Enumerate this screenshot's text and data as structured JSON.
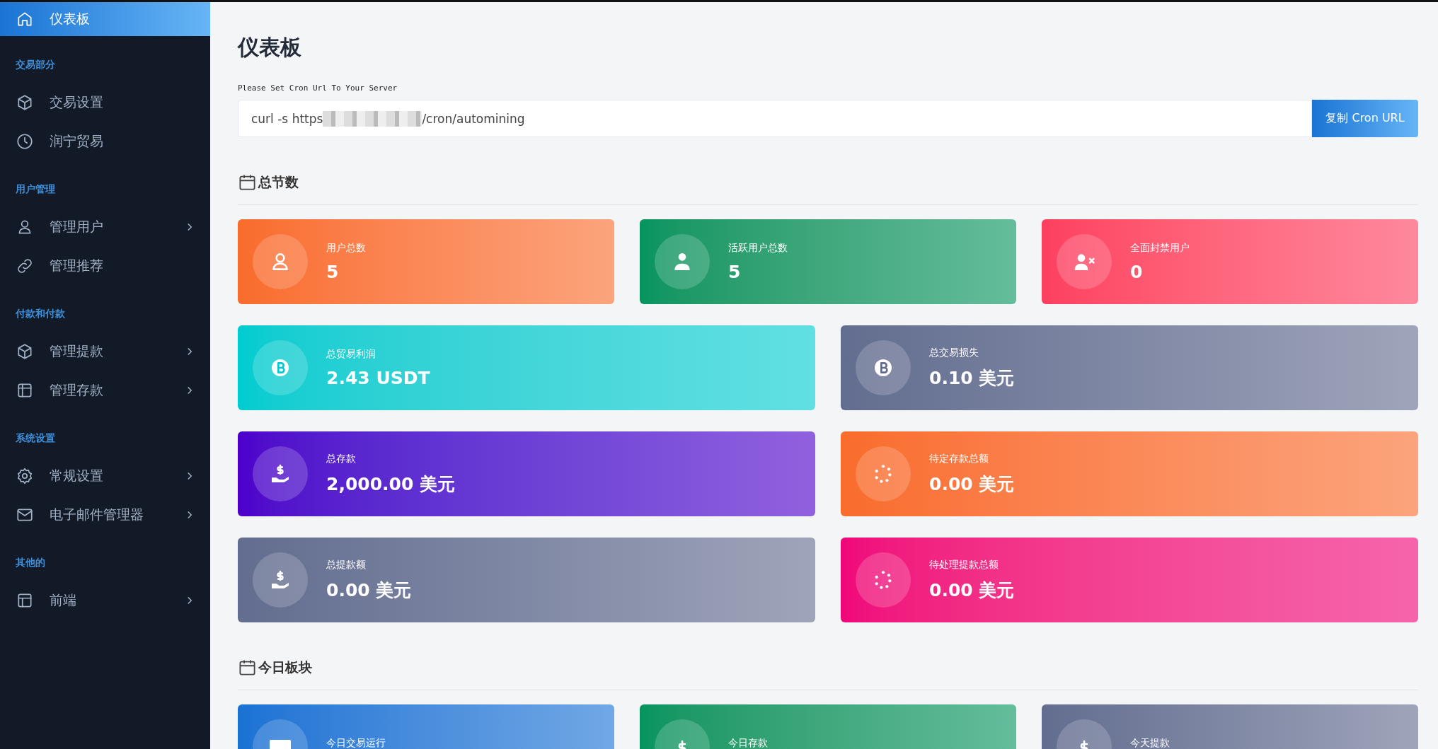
{
  "sidebar": {
    "items": [
      {
        "label": "仪表板",
        "kind": "home",
        "selected": true
      }
    ],
    "sections": [
      {
        "title": "交易部分",
        "items": [
          {
            "label": "交易设置",
            "kind": "cube",
            "selected": false,
            "expandable": false
          },
          {
            "label": "润宁贸易",
            "kind": "clock",
            "selected": false,
            "expandable": false
          }
        ]
      },
      {
        "title": "用户管理",
        "items": [
          {
            "label": "管理用户",
            "kind": "user",
            "selected": false,
            "expandable": true
          },
          {
            "label": "管理推荐",
            "kind": "link",
            "selected": false,
            "expandable": false
          }
        ]
      },
      {
        "title": "付款和付款",
        "items": [
          {
            "label": "管理提款",
            "kind": "cube",
            "selected": false,
            "expandable": true
          },
          {
            "label": "管理存款",
            "kind": "table",
            "selected": false,
            "expandable": true
          }
        ]
      },
      {
        "title": "系统设置",
        "items": [
          {
            "label": "常规设置",
            "kind": "gear",
            "selected": false,
            "expandable": true
          },
          {
            "label": "电子邮件管理器",
            "kind": "mail",
            "selected": false,
            "expandable": true
          }
        ]
      },
      {
        "title": "其他的",
        "items": [
          {
            "label": "前端",
            "kind": "layout",
            "selected": false,
            "expandable": true
          }
        ]
      }
    ]
  },
  "page": {
    "title": "仪表板",
    "cron_hint": "Please Set Cron Url To Your Server",
    "cron_value_start": "curl -s https",
    "cron_value_end": "/cron/automining",
    "copy_button": "复制 Cron URL"
  },
  "sections": [
    {
      "title": "总节数",
      "rows": [
        [
          {
            "label": "用户总数",
            "value": "5",
            "kind": "user",
            "color": "#f96c2c"
          },
          {
            "label": "活跃用户总数",
            "value": "5",
            "kind": "user-tie",
            "color": "#05945f"
          },
          {
            "label": "全面封禁用户",
            "value": "0",
            "kind": "user-x",
            "color": "#fd3f60"
          }
        ],
        [
          {
            "label": "总贸易利润",
            "value": "2.43 USDT",
            "kind": "bitcoin",
            "color": "#00ccd0"
          },
          {
            "label": "总交易损失",
            "value": "0.10 美元",
            "kind": "bitcoin",
            "color": "#636d8f"
          }
        ],
        [
          {
            "label": "总存款",
            "value": "2,000.00 美元",
            "kind": "hand-dollar",
            "color": "#4d00ca"
          },
          {
            "label": "待定存款总额",
            "value": "0.00 美元",
            "kind": "spinner",
            "color": "#f96c2c"
          }
        ],
        [
          {
            "label": "总提款额",
            "value": "0.00 美元",
            "kind": "hand-dollar",
            "color": "#636d8f"
          },
          {
            "label": "待处理提款总额",
            "value": "0.00 美元",
            "kind": "spinner",
            "color": "#f0057a"
          }
        ]
      ]
    },
    {
      "title": "今日板块",
      "rows": [
        [
          {
            "label": "今日交易运行",
            "kind": "cash",
            "color": "#1a72d4"
          },
          {
            "label": "今日存款",
            "kind": "dollar",
            "color": "#05945f"
          },
          {
            "label": "今天提款",
            "kind": "dollar",
            "color": "#636d8f"
          }
        ]
      ]
    }
  ]
}
